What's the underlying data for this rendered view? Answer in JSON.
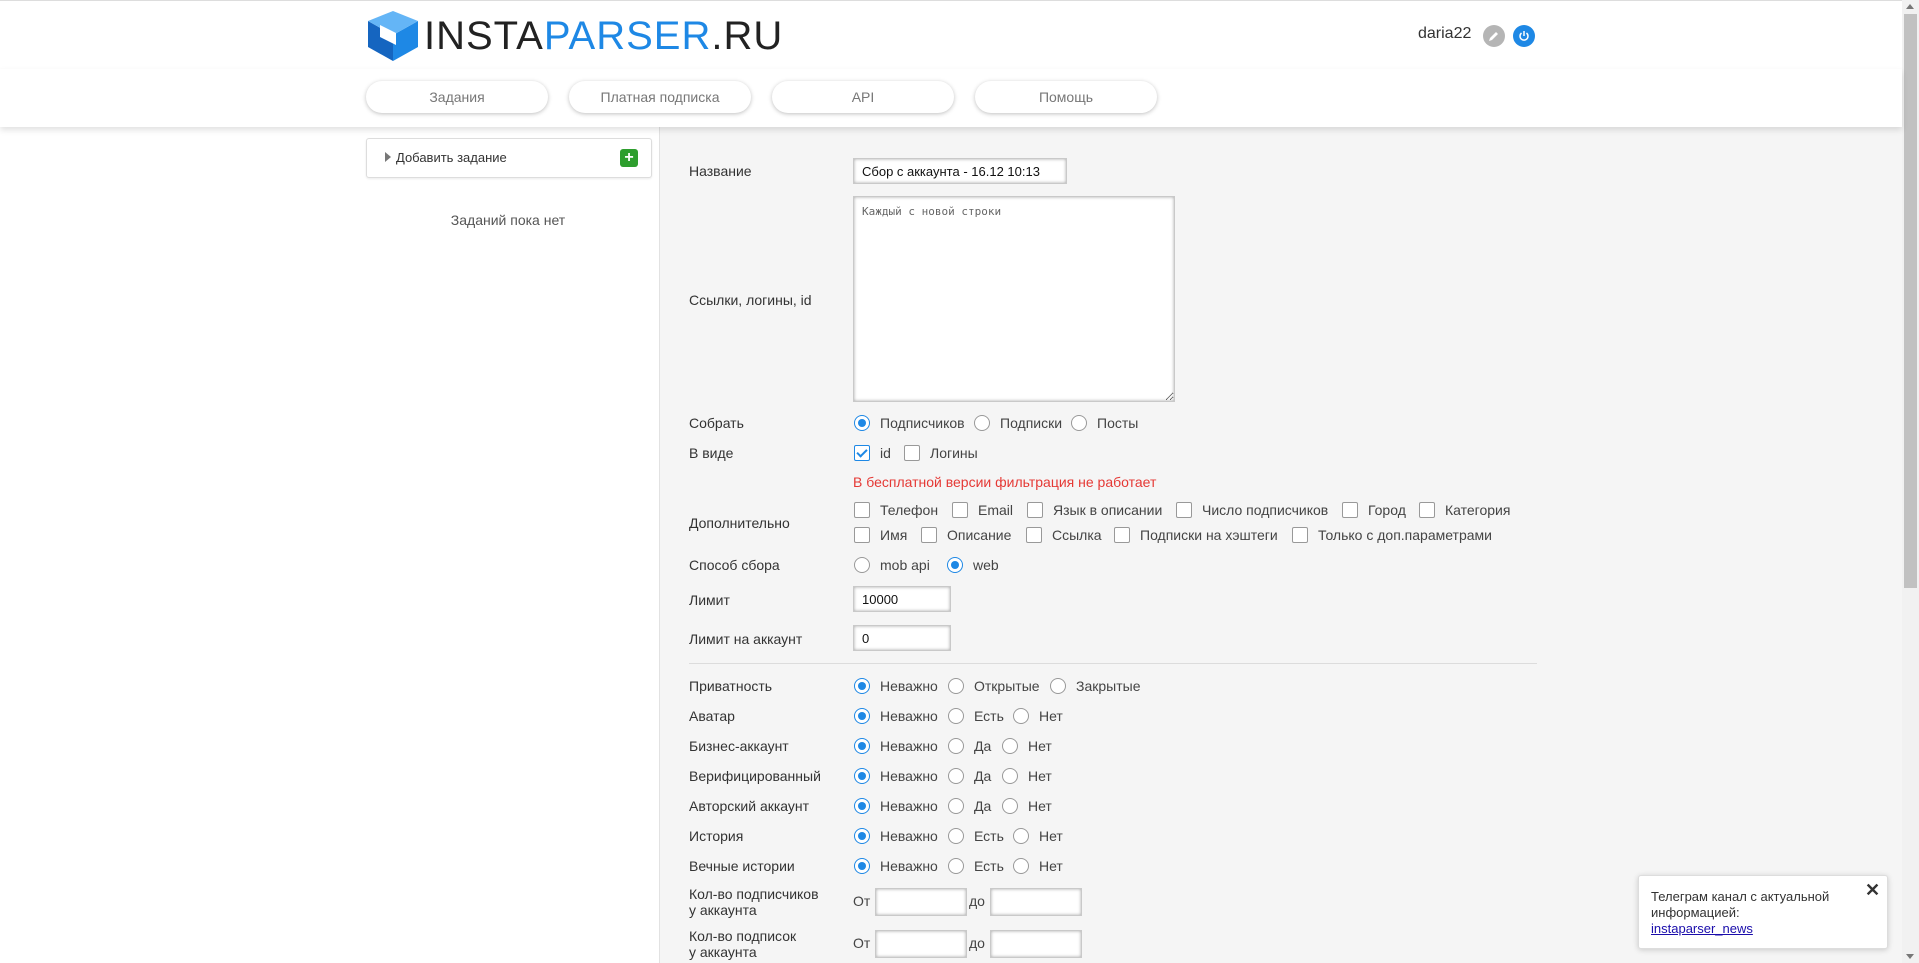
{
  "header": {
    "logo_part1": "INSTA",
    "logo_part2": "PARSER",
    "logo_part3": ".RU",
    "username": "daria22"
  },
  "nav": [
    "Задания",
    "Платная подписка",
    "API",
    "Помощь"
  ],
  "sidebar": {
    "add_task": "Добавить задание",
    "empty": "Заданий пока нет"
  },
  "form": {
    "name_label": "Название",
    "name_value": "Сбор с аккаунта - 16.12 10:13",
    "links_label": "Ссылки, логины, id",
    "links_placeholder": "Каждый с новой строки",
    "collect_label": "Собрать",
    "collect_options": [
      "Подписчиков",
      "Подписки",
      "Посты"
    ],
    "collect_selected": "Подписчиков",
    "as_label": "В виде",
    "as_options": [
      "id",
      "Логины"
    ],
    "as_checked": [
      "id"
    ],
    "warning": "В бесплатной версии фильтрация не работает",
    "extra_label": "Дополнительно",
    "extra_row1": [
      "Телефон",
      "Email",
      "Язык в описании",
      "Число подписчиков",
      "Город",
      "Категория"
    ],
    "extra_row2": [
      "Имя",
      "Описание",
      "Ссылка",
      "Подписки на хэштеги",
      "Только с доп.параметрами"
    ],
    "method_label": "Способ сбора",
    "method_options": [
      "mob api",
      "web"
    ],
    "method_selected": "web",
    "limit_label": "Лимит",
    "limit_value": "10000",
    "limit_acc_label": "Лимит на аккаунт",
    "limit_acc_value": "0",
    "filters": [
      {
        "label": "Приватность",
        "options": [
          "Неважно",
          "Открытые",
          "Закрытые"
        ]
      },
      {
        "label": "Аватар",
        "options": [
          "Неважно",
          "Есть",
          "Нет"
        ]
      },
      {
        "label": "Бизнес-аккаунт",
        "options": [
          "Неважно",
          "Да",
          "Нет"
        ]
      },
      {
        "label": "Верифицированный",
        "options": [
          "Неважно",
          "Да",
          "Нет"
        ]
      },
      {
        "label": "Авторский аккаунт",
        "options": [
          "Неважно",
          "Да",
          "Нет"
        ]
      },
      {
        "label": "История",
        "options": [
          "Неважно",
          "Есть",
          "Нет"
        ]
      },
      {
        "label": "Вечные истории",
        "options": [
          "Неважно",
          "Есть",
          "Нет"
        ]
      }
    ],
    "filters_selected": "Неважно",
    "followers_label_1": "Кол-во подписчиков",
    "followers_label_2": "у аккаунта",
    "following_label_1": "Кол-во подписок",
    "following_label_2": "у аккаунта",
    "from": "От",
    "to": "до"
  },
  "toast": {
    "text": "Телеграм канал с актуальной информацией:",
    "link": "instaparser_news",
    "close": "✕"
  },
  "colors": {
    "accent": "#1e88e5",
    "warning": "#e53935",
    "add_button": "#2e9e2e"
  }
}
